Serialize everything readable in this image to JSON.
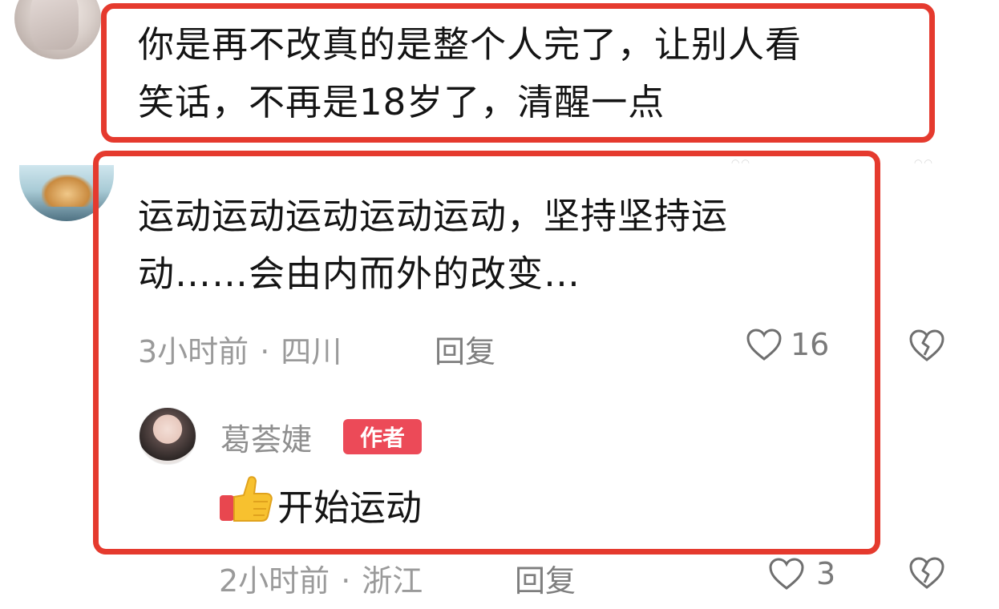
{
  "comment_1": {
    "line_1": "你是再不改真的是整个人完了，让别人看",
    "line_2": "笑话，不再是18岁了，清醒一点"
  },
  "comment_2": {
    "line_1": "运动运动运动运动运动，坚持坚持运",
    "line_2": "动……会由内而外的改变…",
    "time": "3小时前",
    "separator": "·",
    "location": "四川",
    "reply_label": "回复",
    "like_count": "16"
  },
  "author_reply": {
    "author_name": "葛荟婕",
    "author_badge": "作者",
    "text": "开始运动",
    "time": "2小时前",
    "separator": "·",
    "location": "浙江",
    "reply_label": "回复",
    "like_count": "3"
  },
  "icons": {
    "like": "heart-outline-icon",
    "dislike": "broken-heart-icon",
    "emoji": "thumbs-up-emoji"
  },
  "colors": {
    "highlight_border": "#e53a2e",
    "author_badge_bg": "#ec4a58",
    "meta_text": "#9a9a9a"
  }
}
